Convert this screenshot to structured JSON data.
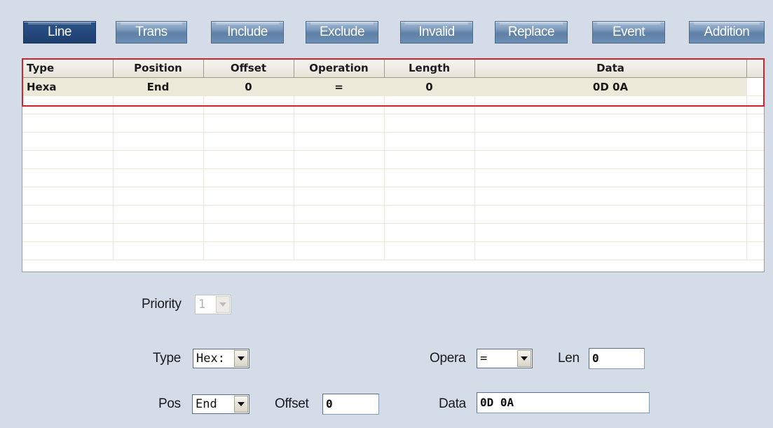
{
  "tabs": [
    {
      "label": "Line",
      "active": true
    },
    {
      "label": "Trans",
      "active": false
    },
    {
      "label": "Include",
      "active": false
    },
    {
      "label": "Exclude",
      "active": false
    },
    {
      "label": "Invalid",
      "active": false
    },
    {
      "label": "Replace",
      "active": false
    },
    {
      "label": "Event",
      "active": false
    },
    {
      "label": "Addition",
      "active": false
    }
  ],
  "grid": {
    "columns": [
      "Type",
      "Position",
      "Offset",
      "Operation",
      "Length",
      "Data"
    ],
    "rows": [
      [
        "Hexa",
        "End",
        "0",
        "=",
        "0",
        "0D 0A"
      ]
    ]
  },
  "form": {
    "priority_label": "Priority",
    "priority_value": "1",
    "type_label": "Type",
    "type_value": "Hex:",
    "opera_label": "Opera",
    "opera_value": "=",
    "len_label": "Len",
    "len_value": "0",
    "pos_label": "Pos",
    "pos_value": "End",
    "offset_label": "Offset",
    "offset_value": "0",
    "data_label": "Data",
    "data_value": "0D 0A"
  },
  "colors": {
    "background": "#d4dce8",
    "tab_active": "#24497d",
    "tab_inactive": "#6e8fb4",
    "selection_outline": "#d2232a",
    "selected_row": "#ece9d9"
  }
}
